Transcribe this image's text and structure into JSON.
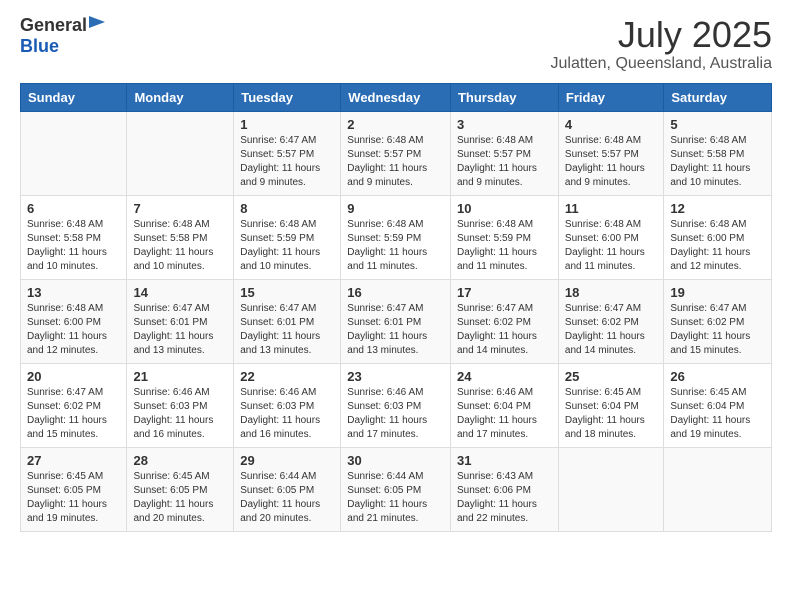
{
  "logo": {
    "general": "General",
    "blue": "Blue"
  },
  "title": {
    "month": "July 2025",
    "location": "Julatten, Queensland, Australia"
  },
  "weekdays": [
    "Sunday",
    "Monday",
    "Tuesday",
    "Wednesday",
    "Thursday",
    "Friday",
    "Saturday"
  ],
  "weeks": [
    [
      {
        "day": "",
        "sunrise": "",
        "sunset": "",
        "daylight": ""
      },
      {
        "day": "",
        "sunrise": "",
        "sunset": "",
        "daylight": ""
      },
      {
        "day": "1",
        "sunrise": "Sunrise: 6:47 AM",
        "sunset": "Sunset: 5:57 PM",
        "daylight": "Daylight: 11 hours and 9 minutes."
      },
      {
        "day": "2",
        "sunrise": "Sunrise: 6:48 AM",
        "sunset": "Sunset: 5:57 PM",
        "daylight": "Daylight: 11 hours and 9 minutes."
      },
      {
        "day": "3",
        "sunrise": "Sunrise: 6:48 AM",
        "sunset": "Sunset: 5:57 PM",
        "daylight": "Daylight: 11 hours and 9 minutes."
      },
      {
        "day": "4",
        "sunrise": "Sunrise: 6:48 AM",
        "sunset": "Sunset: 5:57 PM",
        "daylight": "Daylight: 11 hours and 9 minutes."
      },
      {
        "day": "5",
        "sunrise": "Sunrise: 6:48 AM",
        "sunset": "Sunset: 5:58 PM",
        "daylight": "Daylight: 11 hours and 10 minutes."
      }
    ],
    [
      {
        "day": "6",
        "sunrise": "Sunrise: 6:48 AM",
        "sunset": "Sunset: 5:58 PM",
        "daylight": "Daylight: 11 hours and 10 minutes."
      },
      {
        "day": "7",
        "sunrise": "Sunrise: 6:48 AM",
        "sunset": "Sunset: 5:58 PM",
        "daylight": "Daylight: 11 hours and 10 minutes."
      },
      {
        "day": "8",
        "sunrise": "Sunrise: 6:48 AM",
        "sunset": "Sunset: 5:59 PM",
        "daylight": "Daylight: 11 hours and 10 minutes."
      },
      {
        "day": "9",
        "sunrise": "Sunrise: 6:48 AM",
        "sunset": "Sunset: 5:59 PM",
        "daylight": "Daylight: 11 hours and 11 minutes."
      },
      {
        "day": "10",
        "sunrise": "Sunrise: 6:48 AM",
        "sunset": "Sunset: 5:59 PM",
        "daylight": "Daylight: 11 hours and 11 minutes."
      },
      {
        "day": "11",
        "sunrise": "Sunrise: 6:48 AM",
        "sunset": "Sunset: 6:00 PM",
        "daylight": "Daylight: 11 hours and 11 minutes."
      },
      {
        "day": "12",
        "sunrise": "Sunrise: 6:48 AM",
        "sunset": "Sunset: 6:00 PM",
        "daylight": "Daylight: 11 hours and 12 minutes."
      }
    ],
    [
      {
        "day": "13",
        "sunrise": "Sunrise: 6:48 AM",
        "sunset": "Sunset: 6:00 PM",
        "daylight": "Daylight: 11 hours and 12 minutes."
      },
      {
        "day": "14",
        "sunrise": "Sunrise: 6:47 AM",
        "sunset": "Sunset: 6:01 PM",
        "daylight": "Daylight: 11 hours and 13 minutes."
      },
      {
        "day": "15",
        "sunrise": "Sunrise: 6:47 AM",
        "sunset": "Sunset: 6:01 PM",
        "daylight": "Daylight: 11 hours and 13 minutes."
      },
      {
        "day": "16",
        "sunrise": "Sunrise: 6:47 AM",
        "sunset": "Sunset: 6:01 PM",
        "daylight": "Daylight: 11 hours and 13 minutes."
      },
      {
        "day": "17",
        "sunrise": "Sunrise: 6:47 AM",
        "sunset": "Sunset: 6:02 PM",
        "daylight": "Daylight: 11 hours and 14 minutes."
      },
      {
        "day": "18",
        "sunrise": "Sunrise: 6:47 AM",
        "sunset": "Sunset: 6:02 PM",
        "daylight": "Daylight: 11 hours and 14 minutes."
      },
      {
        "day": "19",
        "sunrise": "Sunrise: 6:47 AM",
        "sunset": "Sunset: 6:02 PM",
        "daylight": "Daylight: 11 hours and 15 minutes."
      }
    ],
    [
      {
        "day": "20",
        "sunrise": "Sunrise: 6:47 AM",
        "sunset": "Sunset: 6:02 PM",
        "daylight": "Daylight: 11 hours and 15 minutes."
      },
      {
        "day": "21",
        "sunrise": "Sunrise: 6:46 AM",
        "sunset": "Sunset: 6:03 PM",
        "daylight": "Daylight: 11 hours and 16 minutes."
      },
      {
        "day": "22",
        "sunrise": "Sunrise: 6:46 AM",
        "sunset": "Sunset: 6:03 PM",
        "daylight": "Daylight: 11 hours and 16 minutes."
      },
      {
        "day": "23",
        "sunrise": "Sunrise: 6:46 AM",
        "sunset": "Sunset: 6:03 PM",
        "daylight": "Daylight: 11 hours and 17 minutes."
      },
      {
        "day": "24",
        "sunrise": "Sunrise: 6:46 AM",
        "sunset": "Sunset: 6:04 PM",
        "daylight": "Daylight: 11 hours and 17 minutes."
      },
      {
        "day": "25",
        "sunrise": "Sunrise: 6:45 AM",
        "sunset": "Sunset: 6:04 PM",
        "daylight": "Daylight: 11 hours and 18 minutes."
      },
      {
        "day": "26",
        "sunrise": "Sunrise: 6:45 AM",
        "sunset": "Sunset: 6:04 PM",
        "daylight": "Daylight: 11 hours and 19 minutes."
      }
    ],
    [
      {
        "day": "27",
        "sunrise": "Sunrise: 6:45 AM",
        "sunset": "Sunset: 6:05 PM",
        "daylight": "Daylight: 11 hours and 19 minutes."
      },
      {
        "day": "28",
        "sunrise": "Sunrise: 6:45 AM",
        "sunset": "Sunset: 6:05 PM",
        "daylight": "Daylight: 11 hours and 20 minutes."
      },
      {
        "day": "29",
        "sunrise": "Sunrise: 6:44 AM",
        "sunset": "Sunset: 6:05 PM",
        "daylight": "Daylight: 11 hours and 20 minutes."
      },
      {
        "day": "30",
        "sunrise": "Sunrise: 6:44 AM",
        "sunset": "Sunset: 6:05 PM",
        "daylight": "Daylight: 11 hours and 21 minutes."
      },
      {
        "day": "31",
        "sunrise": "Sunrise: 6:43 AM",
        "sunset": "Sunset: 6:06 PM",
        "daylight": "Daylight: 11 hours and 22 minutes."
      },
      {
        "day": "",
        "sunrise": "",
        "sunset": "",
        "daylight": ""
      },
      {
        "day": "",
        "sunrise": "",
        "sunset": "",
        "daylight": ""
      }
    ]
  ]
}
